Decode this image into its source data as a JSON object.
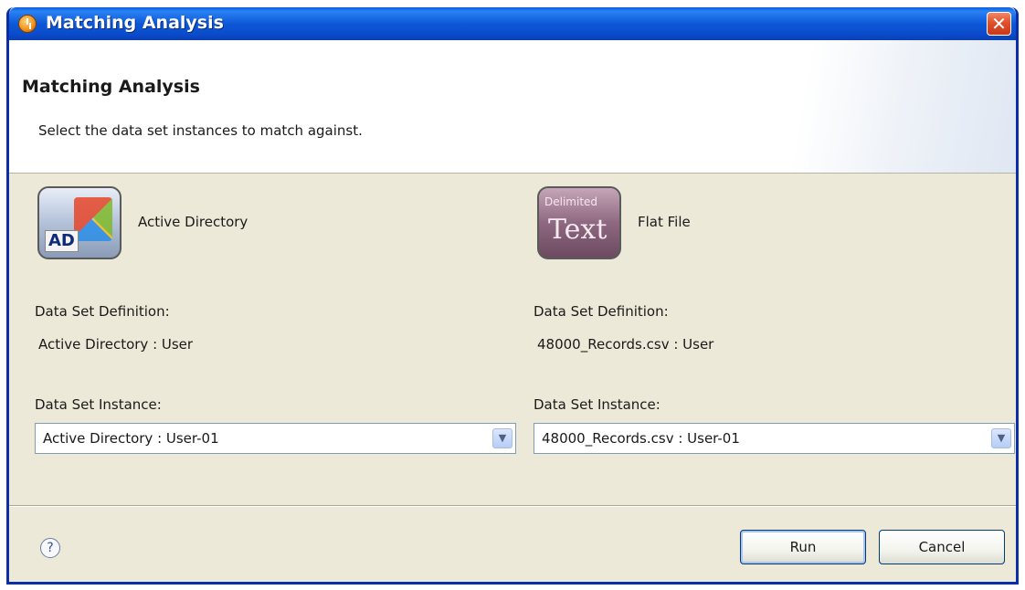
{
  "window": {
    "title": "Matching Analysis",
    "close_glyph": "✕"
  },
  "header": {
    "title": "Matching Analysis",
    "subtitle": "Select the data set instances to match against."
  },
  "left_source": {
    "icon": "active-directory-icon",
    "icon_text": "AD",
    "name": "Active Directory",
    "definition_label": "Data Set Definition:",
    "definition_value": "Active Directory : User",
    "instance_label": "Data Set Instance:",
    "instance_value": "Active Directory : User-01"
  },
  "right_source": {
    "icon": "delimited-text-icon",
    "icon_text_small": "Delimited",
    "icon_text_big": "Text",
    "name": "Flat File",
    "definition_label": "Data Set Definition:",
    "definition_value": "48000_Records.csv : User",
    "instance_label": "Data Set Instance:",
    "instance_value": "48000_Records.csv : User-01"
  },
  "footer": {
    "help_glyph": "?",
    "run_label": "Run",
    "cancel_label": "Cancel"
  },
  "colors": {
    "titlebar": "#0a4ccc",
    "dialog_bg": "#ece9d8",
    "close_button": "#e0502a"
  }
}
